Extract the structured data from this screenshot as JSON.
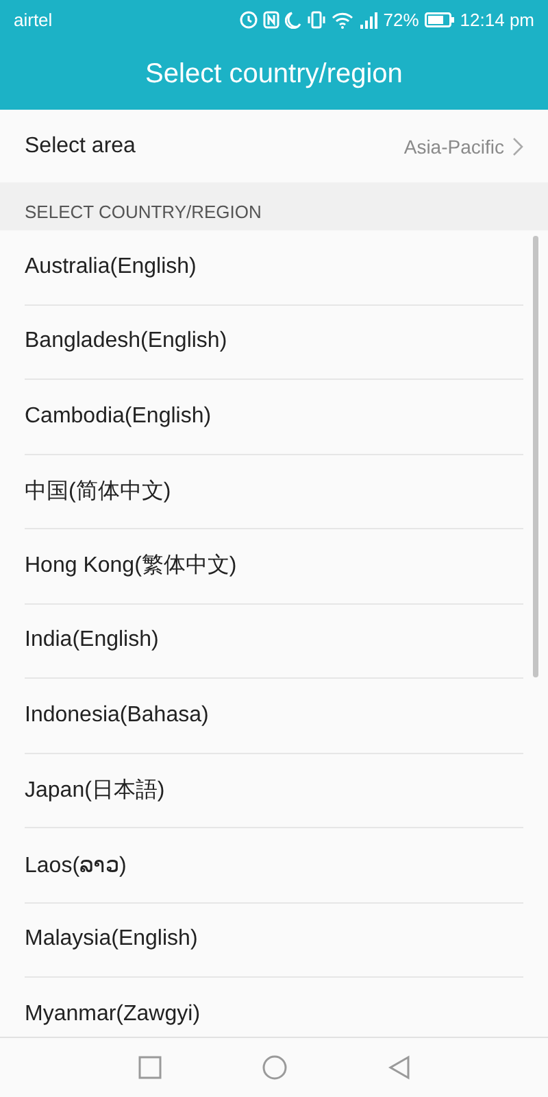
{
  "status_bar": {
    "carrier": "airtel",
    "battery_percent": "72%",
    "time": "12:14 pm"
  },
  "title": "Select country/region",
  "area": {
    "label": "Select area",
    "value": "Asia-Pacific"
  },
  "section_header": "SELECT COUNTRY/REGION",
  "countries": [
    {
      "name": "Australia(English)"
    },
    {
      "name": "Bangladesh(English)"
    },
    {
      "name": "Cambodia(English)"
    },
    {
      "name": "中国(简体中文)"
    },
    {
      "name": "Hong Kong(繁体中文)"
    },
    {
      "name": "India(English)"
    },
    {
      "name": "Indonesia(Bahasa)"
    },
    {
      "name": "Japan(日本語)"
    },
    {
      "name": "Laos(ລາວ)"
    },
    {
      "name": "Malaysia(English)"
    },
    {
      "name": "Myanmar(Zawgyi)"
    }
  ]
}
